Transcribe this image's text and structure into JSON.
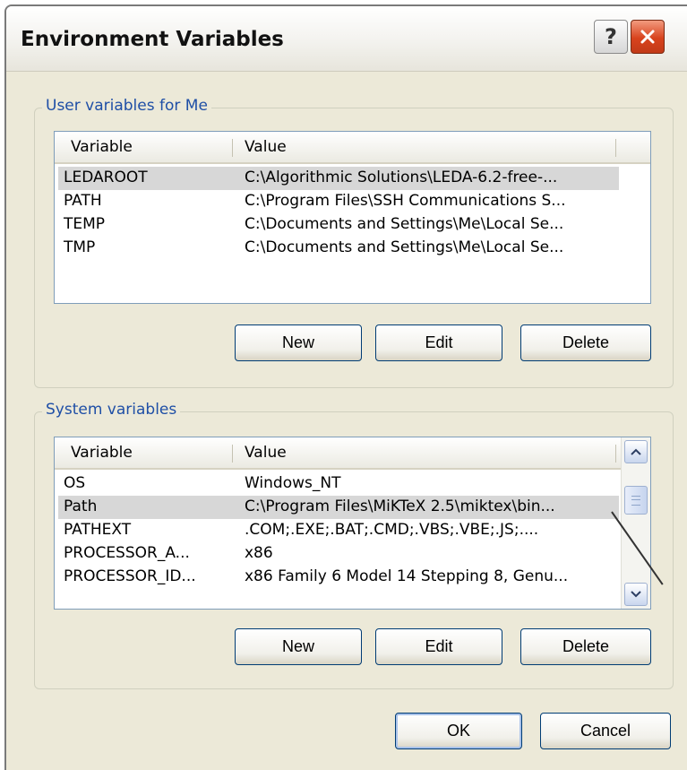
{
  "window": {
    "title": "Environment Variables"
  },
  "titlebar": {
    "help_label": "?",
    "close_label": "✕"
  },
  "user_group": {
    "label": "User variables for Me",
    "columns": [
      "Variable",
      "Value"
    ],
    "rows": [
      {
        "variable": "LEDAROOT",
        "value": "C:\\Algorithmic Solutions\\LEDA-6.2-free-...",
        "selected": true
      },
      {
        "variable": "PATH",
        "value": "C:\\Program Files\\SSH Communications S...",
        "selected": false
      },
      {
        "variable": "TEMP",
        "value": "C:\\Documents and Settings\\Me\\Local Se...",
        "selected": false
      },
      {
        "variable": "TMP",
        "value": "C:\\Documents and Settings\\Me\\Local Se...",
        "selected": false
      }
    ],
    "buttons": {
      "new": "New",
      "edit": "Edit",
      "delete": "Delete"
    }
  },
  "system_group": {
    "label": "System variables",
    "columns": [
      "Variable",
      "Value"
    ],
    "rows": [
      {
        "variable": "OS",
        "value": "Windows_NT",
        "selected": false
      },
      {
        "variable": "Path",
        "value": "C:\\Program Files\\MiKTeX 2.5\\miktex\\bin...",
        "selected": true
      },
      {
        "variable": "PATHEXT",
        "value": ".COM;.EXE;.BAT;.CMD;.VBS;.VBE;.JS;....",
        "selected": false
      },
      {
        "variable": "PROCESSOR_A...",
        "value": "x86",
        "selected": false
      },
      {
        "variable": "PROCESSOR_ID...",
        "value": "x86 Family 6 Model 14 Stepping 8, Genu...",
        "selected": false
      }
    ],
    "buttons": {
      "new": "New",
      "edit": "Edit",
      "delete": "Delete"
    }
  },
  "footer": {
    "ok": "OK",
    "cancel": "Cancel"
  }
}
